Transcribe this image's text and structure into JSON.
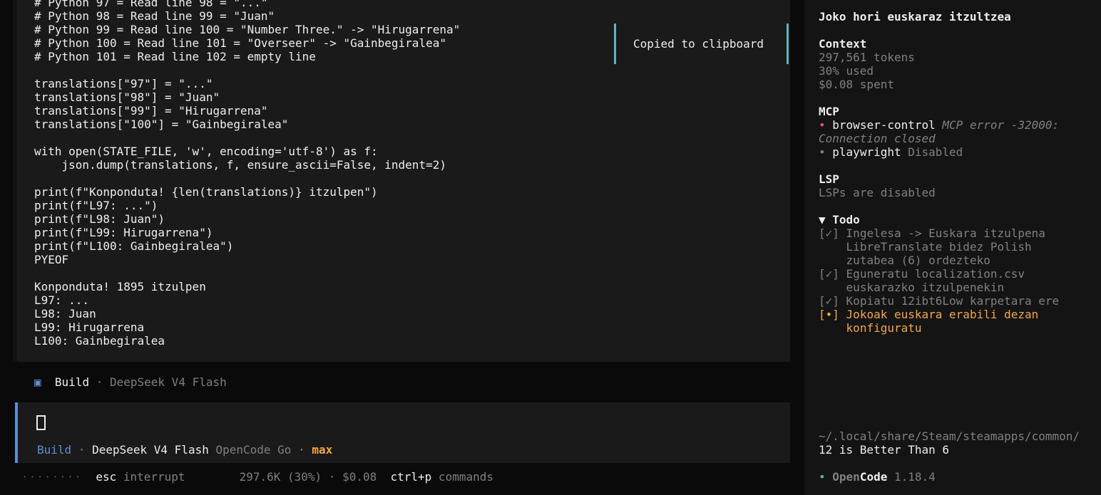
{
  "output": {
    "lines": [
      "# Python 97 = Read line 98 = \"...\"",
      "# Python 98 = Read line 99 = \"Juan\"",
      "# Python 99 = Read line 100 = \"Number Three.\" -> \"Hirugarrena\"",
      "# Python 100 = Read line 101 = \"Overseer\" -> \"Gainbegiralea\"",
      "# Python 101 = Read line 102 = empty line",
      "",
      "translations[\"97\"] = \"...\"",
      "translations[\"98\"] = \"Juan\"",
      "translations[\"99\"] = \"Hirugarrena\"",
      "translations[\"100\"] = \"Gainbegiralea\"",
      "",
      "with open(STATE_FILE, 'w', encoding='utf-8') as f:",
      "    json.dump(translations, f, ensure_ascii=False, indent=2)",
      "",
      "print(f\"Konponduta! {len(translations)} itzulpen\")",
      "print(f\"L97: ...\")",
      "print(f\"L98: Juan\")",
      "print(f\"L99: Hirugarrena\")",
      "print(f\"L100: Gainbegiralea\")",
      "PYEOF",
      "",
      "Konponduta! 1895 itzulpen",
      "L97: ...",
      "L98: Juan",
      "L99: Hirugarrena",
      "L100: Gainbegiralea"
    ]
  },
  "toast": {
    "text": "Copied to clipboard"
  },
  "build_status": {
    "icon": "square-icon",
    "agent": "Build",
    "sep": " · ",
    "model": "DeepSeek V4 Flash"
  },
  "prompt": {
    "agent": "Build",
    "sep1": " · ",
    "model": "DeepSeek V4 Flash",
    "provider": " OpenCode Go",
    "sep2": " · ",
    "variant": "max"
  },
  "footer": {
    "dots": "········",
    "esc_key": "esc",
    "esc_label": " interrupt",
    "usage": "297.6K (30%) · $0.08",
    "cmd_key": "ctrl+p",
    "cmd_label": " commands"
  },
  "sidebar": {
    "title": "Joko hori euskaraz itzultzea",
    "context": {
      "heading": "Context",
      "tokens": "297,561 tokens",
      "used": "30% used",
      "spent": "$0.08 spent"
    },
    "mcp": {
      "heading": "MCP",
      "items": [
        {
          "bullet": "•",
          "name": "browser-control",
          "status_l1": " MCP error -32000:",
          "status_l2": "Connection closed"
        },
        {
          "bullet": "•",
          "name": "playwright",
          "status_l1": " Disabled"
        }
      ]
    },
    "lsp": {
      "heading": "LSP",
      "text": "LSPs are disabled"
    },
    "todo": {
      "heading": "▼ Todo",
      "items": [
        {
          "mark": "[✓]",
          "lines": [
            "Ingelesa -> Euskara itzulpena",
            "LibreTranslate bidez Polish",
            "zutabea (6) ordezteko"
          ]
        },
        {
          "mark": "[✓]",
          "lines": [
            "Eguneratu localization.csv",
            "euskarazko itzulpenekin"
          ]
        },
        {
          "mark": "[✓]",
          "lines": [
            "Kopiatu 12ibt6Low karpetara ere"
          ]
        },
        {
          "mark": "[•]",
          "lines": [
            "Jokoak euskara erabili dezan",
            "konfiguratu"
          ]
        }
      ]
    },
    "path": {
      "line1": "~/.local/share/Steam/steamapps/common/",
      "line2": "12 is Better Than 6"
    },
    "version": {
      "dot": "•",
      "brand_a": "Open",
      "brand_b": "Code",
      "version": " 1.18.4"
    }
  },
  "colors": {
    "accent_blue": "#5b8fd9",
    "toast_border": "#5fb3c1",
    "active_todo": "#f5a742",
    "error_dot": "#e05561",
    "ok_dot": "#4bc27d"
  }
}
